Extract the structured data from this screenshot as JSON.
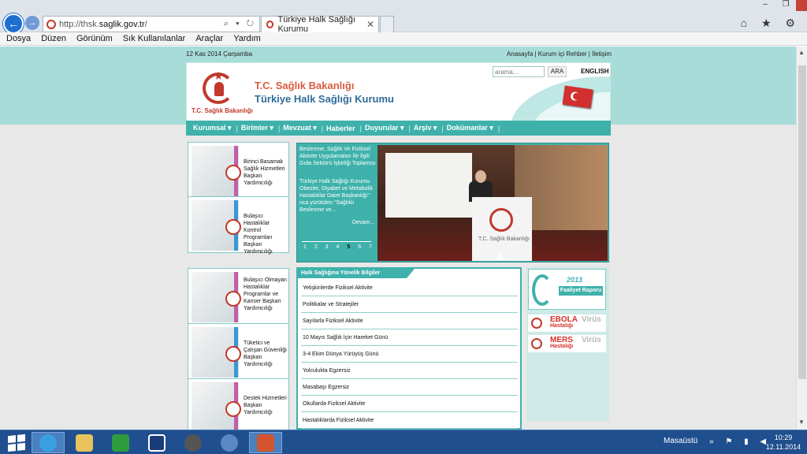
{
  "browser": {
    "url_prefix": "http://thsk.",
    "url_domain": "saglik.gov.tr",
    "url_suffix": "/",
    "address_icons": "⌕ ▾ ↻",
    "tab_title": "Türkiye Halk Sağlığı Kurumu",
    "tab_close": "✕",
    "window_controls": [
      "–",
      "❐",
      "✕"
    ],
    "right_tools": "⌂ ★ ⚙"
  },
  "menubar": [
    "Dosya",
    "Düzen",
    "Görünüm",
    "Sık Kullanılanlar",
    "Araçlar",
    "Yardım"
  ],
  "site": {
    "date": "12 Kas 2014 Çarşamba",
    "top_links": "Anasayfa | Kurum içi Rehber | İletişim",
    "ministry": "T.C. Sağlık Bakanlığı",
    "institution": "Türkiye Halk Sağlığı Kurumu",
    "logo_label": "T.C. Sağlık Bakanlığı",
    "search_placeholder": "arama...",
    "search_button": "ARA",
    "english": "ENGLISH",
    "nav": [
      "Kurumsal ▾",
      "|",
      "Birimler ▾",
      "|",
      "Mevzuat ▾",
      "|",
      "Haberler",
      "|",
      "Duyurular ▾",
      "|",
      "Arşiv ▾",
      "|",
      "Dokümanlar ▾",
      "|"
    ],
    "cards": [
      {
        "label": "Birinci Basamak Sağlık Hizmetleri Başkan Yardımcılığı",
        "stripe": "#c05fa8"
      },
      {
        "label": "Bulaşıcı Hastalıklar Kontrol Programları Başkan Yardımcılığı",
        "stripe": "#3a97d4"
      },
      {
        "label": "Bulaşıcı Olmayan Hastalıklar Programlar ve Kanser Başkan Yardımcılığı",
        "stripe": "#c05fa8"
      },
      {
        "label": "Tüketici ve Çalışan Güvenliği Başkan Yardımcılığı",
        "stripe": "#3a97d4"
      },
      {
        "label": "Destek Hizmetleri Başkan Yardımcılığı",
        "stripe": "#c05fa8"
      }
    ],
    "slider": {
      "title": "Beslenme, Sağlık Ve Fiziksel Aktivite Uygulamaları İle İlgili Gıda Sektörü İşbirliği Toplantısı",
      "body": "Türkiye Halk Sağlığı Kurumu Obezite, Diyabet ve Metabolik Hastalıklar Daire Başkanlığı\" nca yürütülen \"Sağlıklı Beslenme ve...",
      "more": "Devam...",
      "pages_before": "1 2 3 4",
      "page_active": "5",
      "pages_after": "6 7",
      "podium_text": "T.C. Sağlık Bakanlığı"
    },
    "info": {
      "title": "Halk Sağlığına Yönelik Bilgiler",
      "items": [
        "Yetişkinlerde Fiziksel Aktivite",
        "Politikalar ve Stratejiler",
        "Sayılarla Fiziksel Aktivite",
        "10 Mayıs Sağlık İçin Hareket Günü",
        "3-4 Ekim Dünya Yürüyüş Günü",
        "Yolculukta Egzersiz",
        "Masabaşı Egzersiz",
        "Okullarda Fiziksel Aktivite",
        "Hastalıklarda Fiziksel Aktivite"
      ]
    },
    "right": {
      "report_year": "2013",
      "report_label": "Faaliyet Raporu",
      "banners": [
        {
          "word": "EBOLA",
          "virus": "Virüs",
          "sub": "Hastalığı"
        },
        {
          "word": "MERS",
          "virus": "Virüs",
          "sub": "Hastalığı"
        }
      ]
    }
  },
  "taskbar": {
    "desktop_label": "Masaüstü",
    "tray_icons": "» ⚑ ▮ ◀",
    "time": "10:29",
    "date": "12.11.2014"
  }
}
